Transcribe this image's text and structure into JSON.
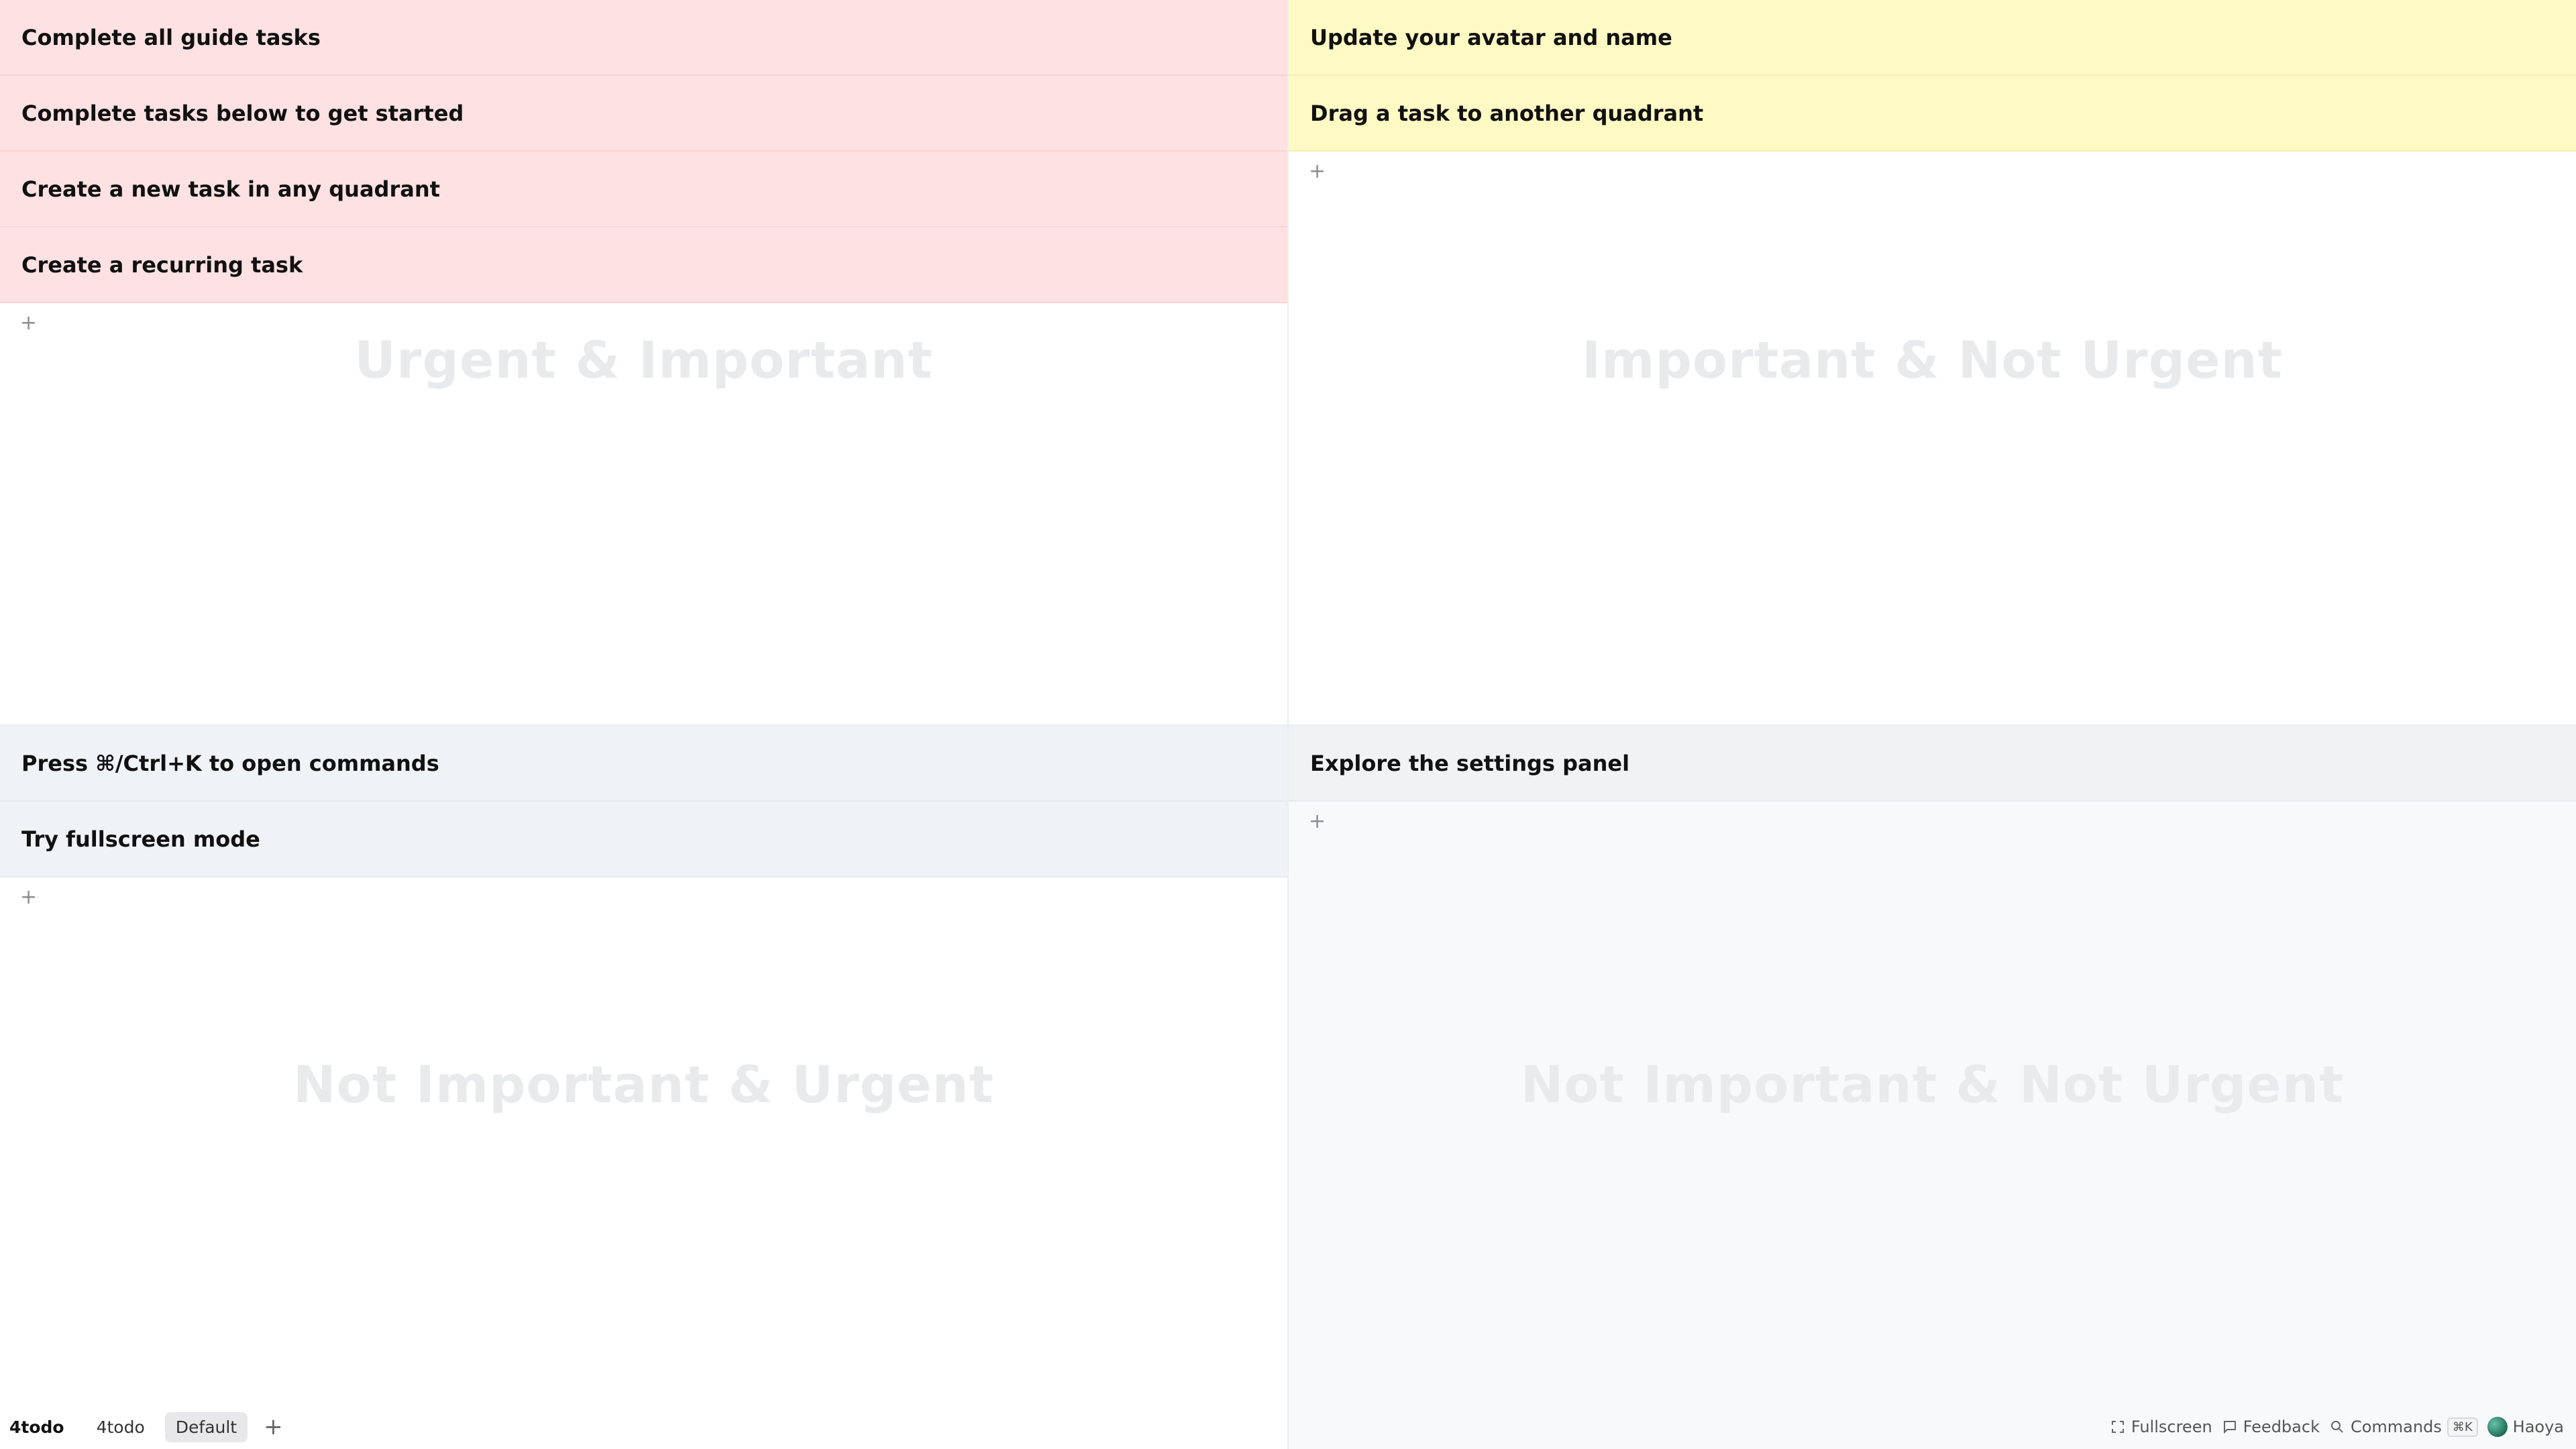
{
  "quadrants": {
    "q1": {
      "title": "Urgent & Important",
      "color": "#fee1e2",
      "tasks": [
        {
          "label": "Complete all guide tasks"
        },
        {
          "label": "Complete tasks below to get started"
        },
        {
          "label": "Create a new task in any quadrant"
        },
        {
          "label": "Create a recurring task"
        }
      ],
      "add_label": "+"
    },
    "q2": {
      "title": "Important & Not Urgent",
      "color": "#fff9c4",
      "tasks": [
        {
          "label": "Update your avatar and name"
        },
        {
          "label": "Drag a task to another quadrant"
        }
      ],
      "add_label": "+"
    },
    "q3": {
      "title": "Not Important & Urgent",
      "color": "#eff3f7",
      "tasks": [
        {
          "label": "Press ⌘/Ctrl+K to open commands"
        },
        {
          "label": "Try fullscreen mode"
        }
      ],
      "add_label": "+"
    },
    "q4": {
      "title": "Not Important & Not Urgent",
      "color": "#f0f2f4",
      "tasks": [
        {
          "label": "Explore the settings panel"
        }
      ],
      "add_label": "+"
    }
  },
  "bottom_bar": {
    "brand": "4todo",
    "tabs": [
      {
        "label": "4todo",
        "active": false
      },
      {
        "label": "Default",
        "active": true
      }
    ],
    "add_tab_label": "+",
    "fullscreen_label": "Fullscreen",
    "feedback_label": "Feedback",
    "commands_label": "Commands",
    "commands_shortcut": "⌘K",
    "user_name": "Haoya",
    "icons": [
      "fullscreen-icon",
      "feedback-icon",
      "search-icon",
      "avatar"
    ]
  }
}
